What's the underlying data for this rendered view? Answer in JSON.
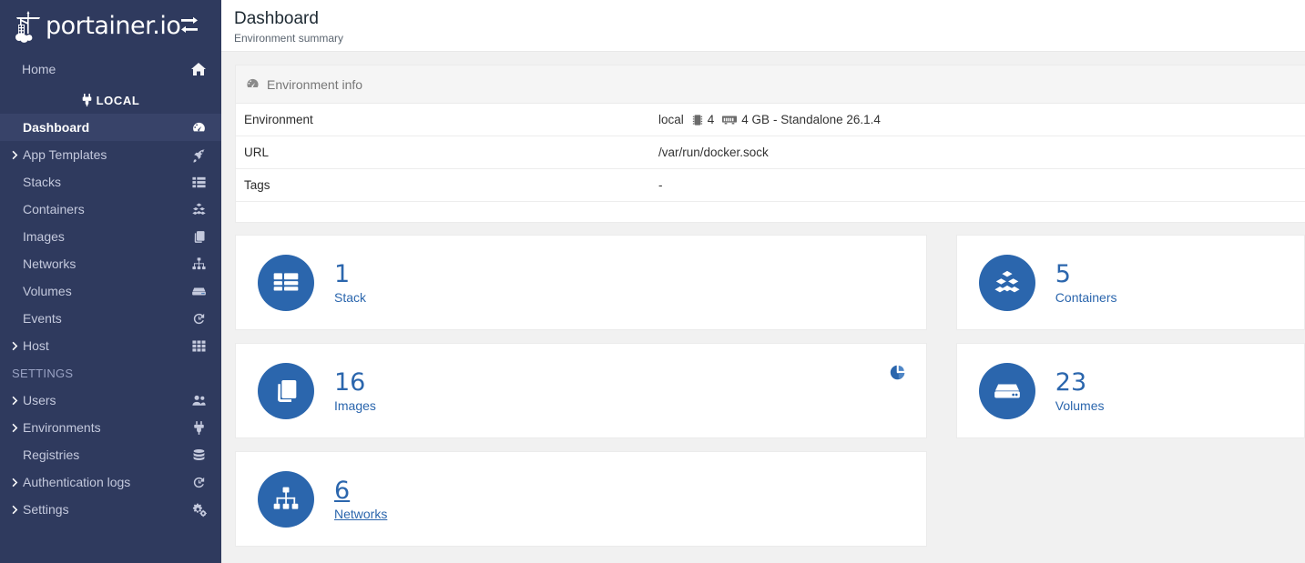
{
  "sidebar": {
    "brand": {
      "text": "portainer.io",
      "logo_icon": "portainer-logo-icon",
      "toggle_icon": "sidebar-toggle-icon"
    },
    "home": {
      "label": "Home",
      "icon": "home-icon"
    },
    "environment_badge": {
      "label": "LOCAL",
      "icon": "plug-icon"
    },
    "items": [
      {
        "label": "Dashboard",
        "icon": "tachometer-icon",
        "caret": false,
        "active": true
      },
      {
        "label": "App Templates",
        "icon": "rocket-icon",
        "caret": true,
        "active": false
      },
      {
        "label": "Stacks",
        "icon": "list-icon",
        "caret": false,
        "active": false
      },
      {
        "label": "Containers",
        "icon": "containers-icon",
        "caret": false,
        "active": false
      },
      {
        "label": "Images",
        "icon": "images-icon",
        "caret": false,
        "active": false
      },
      {
        "label": "Networks",
        "icon": "sitemap-icon",
        "caret": false,
        "active": false
      },
      {
        "label": "Volumes",
        "icon": "hdd-icon",
        "caret": false,
        "active": false
      },
      {
        "label": "Events",
        "icon": "history-icon",
        "caret": false,
        "active": false
      },
      {
        "label": "Host",
        "icon": "th-icon",
        "caret": true,
        "active": false
      }
    ],
    "section_label": "SETTINGS",
    "settings_items": [
      {
        "label": "Users",
        "icon": "users-icon",
        "caret": true
      },
      {
        "label": "Environments",
        "icon": "plug-icon",
        "caret": true
      },
      {
        "label": "Registries",
        "icon": "database-icon",
        "caret": false
      },
      {
        "label": "Authentication logs",
        "icon": "history-icon",
        "caret": true
      },
      {
        "label": "Settings",
        "icon": "cogs-icon",
        "caret": true
      }
    ]
  },
  "header": {
    "title": "Dashboard",
    "subtitle": "Environment summary"
  },
  "environment_panel": {
    "title": "Environment info",
    "icon": "tachometer-icon",
    "rows": [
      {
        "key": "Environment",
        "value_name": "local",
        "cpu_icon": "cpu-icon",
        "cpu_count": "4",
        "memory_icon": "memory-icon",
        "memory": "4 GB",
        "value_suffix": "- Standalone 26.1.4"
      },
      {
        "key": "URL",
        "value": "/var/run/docker.sock"
      },
      {
        "key": "Tags",
        "value": "-"
      }
    ]
  },
  "cards": {
    "left": [
      {
        "count": "1",
        "label": "Stack",
        "icon": "stack-icon",
        "aux_icon": null,
        "hovered": false
      },
      {
        "count": "16",
        "label": "Images",
        "icon": "images-icon",
        "aux_icon": "pie-chart-icon",
        "hovered": false
      },
      {
        "count": "6",
        "label": "Networks",
        "icon": "sitemap-icon",
        "aux_icon": null,
        "hovered": true
      }
    ],
    "right": [
      {
        "count": "5",
        "label": "Containers",
        "icon": "containers-icon",
        "aux_icon": null,
        "hovered": false
      },
      {
        "count": "23",
        "label": "Volumes",
        "icon": "hdd-icon",
        "aux_icon": null,
        "hovered": false
      }
    ]
  },
  "colors": {
    "sidebar_bg": "#2f3a5e",
    "sidebar_active_bg": "#384369",
    "accent_blue": "#2b66ad",
    "main_bg": "#f1f1f1",
    "panel_head_bg": "#f5f5f5"
  }
}
